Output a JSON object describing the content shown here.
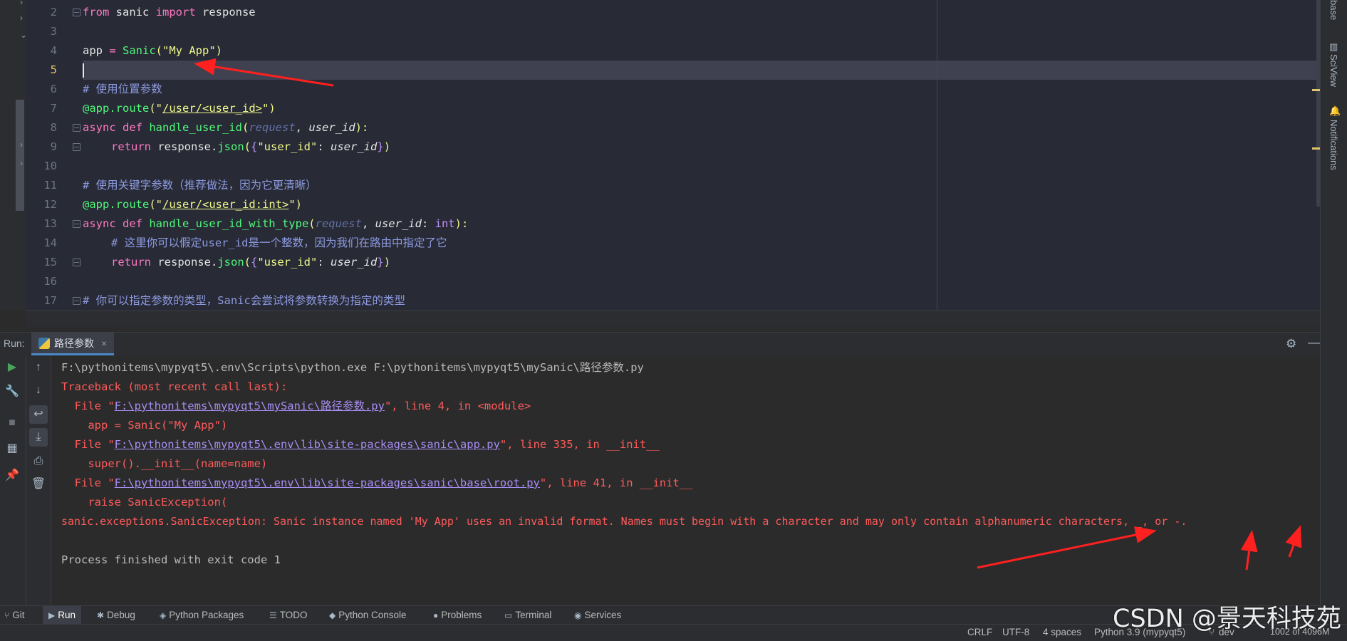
{
  "editor": {
    "line_numbers": [
      "2",
      "3",
      "4",
      "5",
      "6",
      "7",
      "8",
      "9",
      "10",
      "11",
      "12",
      "13",
      "14",
      "15",
      "16",
      "17"
    ],
    "current_line": "5",
    "code": {
      "l2": {
        "kw": "from",
        "mod": " sanic ",
        "kw2": "import",
        "rest": " response"
      },
      "l4": {
        "var": "app",
        "op": " = ",
        "cls": "Sanic",
        "p1": "(",
        "str": "\"My App\"",
        "p2": ")"
      },
      "l6": {
        "comment": "# 使用位置参数"
      },
      "l7": {
        "dec": "@app.route",
        "p1": "(",
        "q1": "\"",
        "url": "/user/<user_id>",
        "q2": "\"",
        "p2": ")"
      },
      "l8": {
        "kw": "async def ",
        "fn": "handle_user_id",
        "p1": "(",
        "param1": "request",
        "sep": ", ",
        "param2": "user_id",
        "p2": "):"
      },
      "l9": {
        "kw": "return ",
        "obj": "response.",
        "fn": "json",
        "p1": "(",
        "b1": "{",
        "key": "\"user_id\"",
        "colon": ": ",
        "val": "user_id",
        "b2": "}",
        "p2": ")"
      },
      "l11": {
        "comment": "# 使用关键字参数（推荐做法，因为它更清晰）"
      },
      "l12": {
        "dec": "@app.route",
        "p1": "(",
        "q1": "\"",
        "url": "/user/<user_id:int>",
        "q2": "\"",
        "p2": ")"
      },
      "l13": {
        "kw": "async def ",
        "fn": "handle_user_id_with_type",
        "p1": "(",
        "param1": "request",
        "sep": ", ",
        "param2": "user_id",
        "colon": ": ",
        "type": "int",
        "p2": "):"
      },
      "l14": {
        "comment": "# 这里你可以假定user_id是一个整数，因为我们在路由中指定了它"
      },
      "l15": {
        "kw": "return ",
        "obj": "response.",
        "fn": "json",
        "p1": "(",
        "b1": "{",
        "key": "\"user_id\"",
        "colon": ": ",
        "val": "user_id",
        "b2": "}",
        "p2": ")"
      },
      "l17": {
        "comment": "# 你可以指定参数的类型，Sanic会尝试将参数转换为指定的类型"
      }
    }
  },
  "right_strip": {
    "database": "base",
    "sciview": "SciView",
    "notifications": "Notifications"
  },
  "run_panel": {
    "label": "Run:",
    "tab": "路径参数",
    "tab_close": "×",
    "settings_icon": "gear-icon",
    "minimize_icon": "minimize-icon",
    "console": {
      "cmd": "F:\\pythonitems\\mypyqt5\\.env\\Scripts\\python.exe F:\\pythonitems\\mypyqt5\\mySanic\\路径参数.py",
      "traceback": "Traceback (most recent call last):",
      "f1_pre": "  File \"",
      "f1_link": "F:\\pythonitems\\mypyqt5\\mySanic\\路径参数.py",
      "f1_post": "\", line 4, in <module>",
      "f1_code": "    app = Sanic(\"My App\")",
      "f2_pre": "  File \"",
      "f2_link": "F:\\pythonitems\\mypyqt5\\.env\\lib\\site-packages\\sanic\\app.py",
      "f2_post": "\", line 335, in __init__",
      "f2_code": "    super().__init__(name=name)",
      "f3_pre": "  File \"",
      "f3_link": "F:\\pythonitems\\mypyqt5\\.env\\lib\\site-packages\\sanic\\base\\root.py",
      "f3_post": "\", line 41, in __init__",
      "f3_code": "    raise SanicException(",
      "exception": "sanic.exceptions.SanicException: Sanic instance named 'My App' uses an invalid format. Names must begin with a character and may only contain alphanumeric characters, _, or -.",
      "exit": "Process finished with exit code 1"
    }
  },
  "tool_windows": [
    {
      "label": "Git",
      "icon": "git-branch-icon"
    },
    {
      "label": "Run",
      "icon": "play-icon"
    },
    {
      "label": "Debug",
      "icon": "bug-icon"
    },
    {
      "label": "Python Packages",
      "icon": "layers-icon"
    },
    {
      "label": "TODO",
      "icon": "list-icon"
    },
    {
      "label": "Python Console",
      "icon": "python-icon"
    },
    {
      "label": "Problems",
      "icon": "info-icon"
    },
    {
      "label": "Terminal",
      "icon": "terminal-icon"
    },
    {
      "label": "Services",
      "icon": "services-icon"
    }
  ],
  "status_bar": {
    "line_sep": "CRLF",
    "encoding": "UTF-8",
    "indent": "4 spaces",
    "interpreter": "Python 3.9 (mypyqt5)",
    "branch": "dev",
    "memory": "1002 of 4096M"
  },
  "watermark": "CSDN @景天科技苑",
  "colors": {
    "annotation_arrow": "#ff2020",
    "active_tab_underline": "#4a88c7",
    "error_text": "#ff5b5b"
  }
}
